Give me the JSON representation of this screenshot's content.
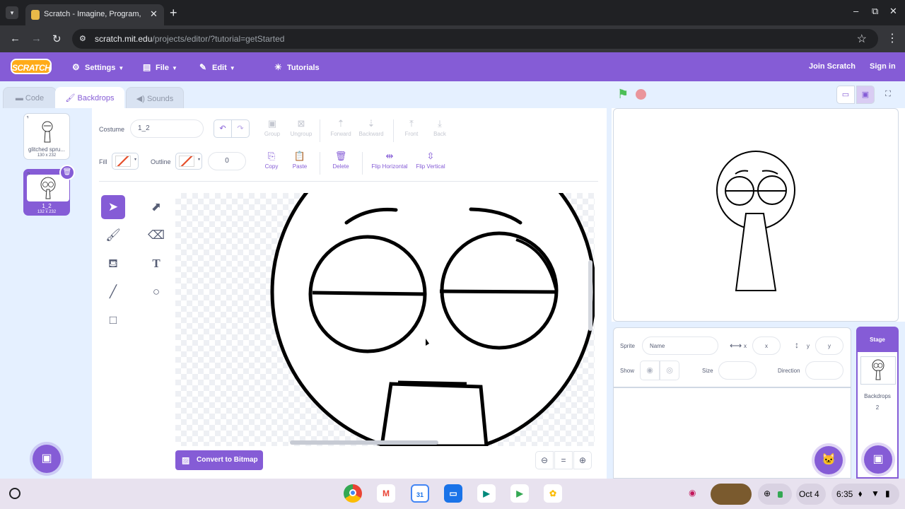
{
  "browser": {
    "tab_title": "Scratch - Imagine, Program, Sh",
    "url_host": "scratch.mit.edu",
    "url_path": "/projects/editor/?tutorial=getStarted"
  },
  "menubar": {
    "logo": "SCRATCH",
    "settings": "Settings",
    "file": "File",
    "edit": "Edit",
    "tutorials": "Tutorials",
    "join": "Join Scratch",
    "signin": "Sign in"
  },
  "tabs": {
    "code": "Code",
    "backdrops": "Backdrops",
    "sounds": "Sounds"
  },
  "costumes": [
    {
      "num": "1",
      "name": "glitched spru...",
      "dims": "130 x 232"
    },
    {
      "num": "2",
      "name": "1_2",
      "dims": "132 x 232"
    }
  ],
  "paint": {
    "costume_label": "Costume",
    "costume_name": "1_2",
    "fill_label": "Fill",
    "outline_label": "Outline",
    "outline_width": "0",
    "group": "Group",
    "ungroup": "Ungroup",
    "forward": "Forward",
    "backward": "Backward",
    "front": "Front",
    "back": "Back",
    "copy": "Copy",
    "paste": "Paste",
    "delete": "Delete",
    "flip_h": "Flip Horizontal",
    "flip_v": "Flip Vertical",
    "convert": "Convert to Bitmap",
    "zoom_reset": "="
  },
  "sprite_info": {
    "sprite_label": "Sprite",
    "name_placeholder": "Name",
    "x_label": "x",
    "x_placeholder": "x",
    "y_label": "y",
    "y_placeholder": "y",
    "show_label": "Show",
    "size_label": "Size",
    "direction_label": "Direction"
  },
  "stage_panel": {
    "title": "Stage",
    "backdrops_label": "Backdrops",
    "backdrops_count": "2"
  },
  "shelf": {
    "date": "Oct 4",
    "time": "6:35"
  },
  "colors": {
    "accent": "#855cd6",
    "menu": "#855cd6",
    "pane_bg": "#e5f0ff",
    "flag": "#4cbf56",
    "stop": "#ec5959"
  }
}
